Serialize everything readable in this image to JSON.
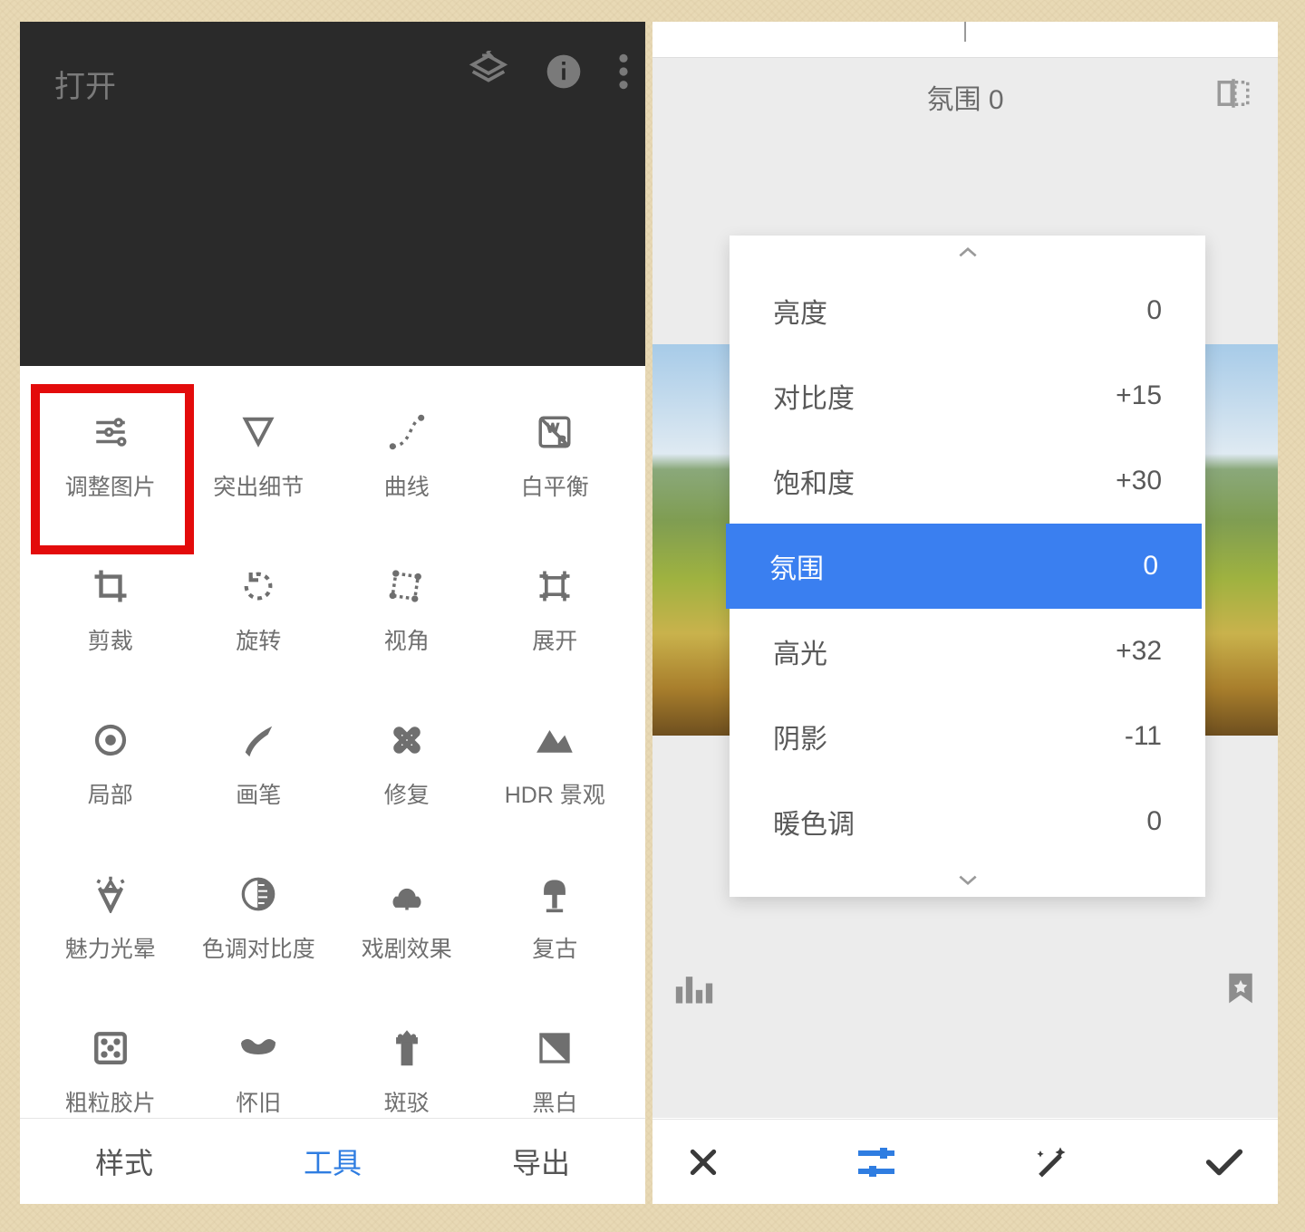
{
  "left": {
    "open_label": "打开",
    "tools": [
      {
        "id": "tune",
        "label": "调整图片",
        "highlight": true
      },
      {
        "id": "details",
        "label": "突出细节"
      },
      {
        "id": "curves",
        "label": "曲线"
      },
      {
        "id": "wb",
        "label": "白平衡"
      },
      {
        "id": "crop",
        "label": "剪裁"
      },
      {
        "id": "rotate",
        "label": "旋转"
      },
      {
        "id": "perspective",
        "label": "视角"
      },
      {
        "id": "expand",
        "label": "展开"
      },
      {
        "id": "selective",
        "label": "局部"
      },
      {
        "id": "brush",
        "label": "画笔"
      },
      {
        "id": "healing",
        "label": "修复"
      },
      {
        "id": "hdr",
        "label": "HDR 景观"
      },
      {
        "id": "glamour",
        "label": "魅力光晕"
      },
      {
        "id": "tonal",
        "label": "色调对比度"
      },
      {
        "id": "drama",
        "label": "戏剧效果"
      },
      {
        "id": "vintage",
        "label": "复古"
      },
      {
        "id": "grainy",
        "label": "粗粒胶片"
      },
      {
        "id": "retrolux",
        "label": "怀旧"
      },
      {
        "id": "grunge",
        "label": "斑驳"
      },
      {
        "id": "bw",
        "label": "黑白"
      }
    ],
    "tabs": {
      "style": "样式",
      "tools": "工具",
      "export": "导出"
    }
  },
  "right": {
    "header_title": "氛围 0",
    "params": [
      {
        "label": "亮度",
        "value": "0"
      },
      {
        "label": "对比度",
        "value": "+15"
      },
      {
        "label": "饱和度",
        "value": "+30"
      },
      {
        "label": "氛围",
        "value": "0",
        "selected": true
      },
      {
        "label": "高光",
        "value": "+32"
      },
      {
        "label": "阴影",
        "value": "-11"
      },
      {
        "label": "暖色调",
        "value": "0"
      }
    ]
  }
}
